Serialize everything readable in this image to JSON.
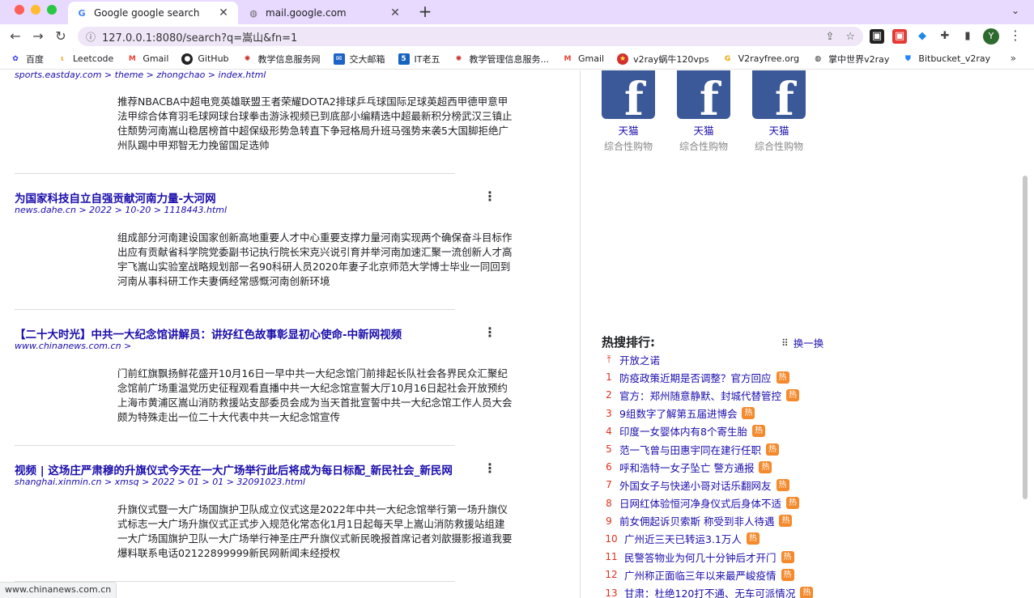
{
  "browser": {
    "tabs": [
      {
        "title": "Google google search",
        "active": true,
        "icon": "google-g-icon"
      },
      {
        "title": "mail.google.com",
        "active": false,
        "icon": "globe-icon"
      }
    ],
    "url": "127.0.0.1:8080/search?q=嵩山&fn=1",
    "avatar_letter": "Y",
    "bookmarks": [
      "百度",
      "Leetcode",
      "Gmail",
      "GitHub",
      "教学信息服务网",
      "交大邮箱",
      "IT老五",
      "教学管理信息服务...",
      "Gmail",
      "v2ray蜗牛120vps",
      "V2rayfree.org",
      "掌中世界v2ray",
      "Bitbucket_v2ray"
    ],
    "status_url": "www.chinanews.com.cn"
  },
  "results": {
    "top_cite": "sports.eastday.com > theme > zhongchao > index.html",
    "top_snippet": "推荐NBACBA中超电竞英雄联盟王者荣耀DOTA2排球乒乓球国际足球英超西甲德甲意甲法甲综合体育羽毛球网球台球拳击游泳视频已到底部小编精选中超最新积分榜武汉三镇止住颓势河南嵩山稳居榜首中超保级形势急转直下争冠格局升班马强势来袭5大国脚拒绝广州队踢中甲郑智无力挽留国足选帅",
    "items": [
      {
        "title": "为国家科技自立自强贡献河南力量-大河网",
        "url": "news.dahe.cn > 2022 > 10-20 > 1118443.html",
        "snippet": "组成部分河南建设国家创新高地重要人才中心重要支撑力量河南实现两个确保奋斗目标作出应有贡献省科学院党委副书记执行院长宋克兴说引育并举河南加速汇聚一流创新人才高宇飞嵩山实验室战略规划部一名90科研人员2020年妻子北京师范大学博士毕业一同回到河南从事科研工作夫妻俩经常感慨河南创新环境"
      },
      {
        "title": "【二十大时光】中共一大纪念馆讲解员：讲好红色故事彰显初心使命-中新网视频",
        "url": "www.chinanews.com.cn >",
        "snippet": "门前红旗飘扬鲜花盛开10月16日一早中共一大纪念馆门前排起长队社会各界民众汇聚纪念馆前广场重温党历史征程观看直播中共一大纪念馆宣誓大厅10月16日起社会开放预约上海市黄浦区嵩山消防救援站支部委员会成为当天首批宣誓中共一大纪念馆工作人员大会颇为特殊走出一位二十大代表中共一大纪念馆宣传"
      },
      {
        "title": "视频 | 这场庄严肃穆的升旗仪式今天在一大广场举行此后将成为每日标配_新民社会_新民网",
        "url": "shanghai.xinmin.cn > xmsq > 2022 > 01 > 01 > 32091023.html",
        "snippet": "升旗仪式暨一大广场国旗护卫队成立仪式这是2022年中共一大纪念馆举行第一场升旗仪式标志一大广场升旗仪式正式步入规范化常态化1月1日起每天早上嵩山消防救援站组建一大广场国旗护卫队一大广场举行神圣庄严升旗仪式新民晚报首席记者刘歆摄影报道我要爆料联系电话02122899999新民网新闻未经授权"
      }
    ]
  },
  "sidebar": {
    "cards": [
      {
        "name": "天猫",
        "desc": "综合性购物"
      },
      {
        "name": "天猫",
        "desc": "综合性购物"
      },
      {
        "name": "天猫",
        "desc": "综合性购物"
      }
    ],
    "hot_title": "热搜排行:",
    "swap_label": "换一换",
    "pinned": "开放之诺",
    "hot_badge": "热",
    "hot_items": [
      {
        "rank": "1",
        "text": "防疫政策近期是否调整？官方回应"
      },
      {
        "rank": "2",
        "text": "官方：郑州随意静默、封城代替管控"
      },
      {
        "rank": "3",
        "text": "9组数字了解第五届进博会"
      },
      {
        "rank": "4",
        "text": "印度一女婴体内有8个寄生胎"
      },
      {
        "rank": "5",
        "text": "范一飞曾与田惠宇同在建行任职"
      },
      {
        "rank": "6",
        "text": "呼和浩特一女子坠亡 警方通报"
      },
      {
        "rank": "7",
        "text": "外国女子与快递小哥对话乐翻网友"
      },
      {
        "rank": "8",
        "text": "日网红体验恒河净身仪式后身体不适"
      },
      {
        "rank": "9",
        "text": "前女佣起诉贝索斯 称受到非人待遇"
      },
      {
        "rank": "10",
        "text": "广州近三天已转运3.1万人"
      },
      {
        "rank": "11",
        "text": "民警答物业为何几十分钟后才开门"
      },
      {
        "rank": "12",
        "text": "广州称正面临三年以来最严峻疫情"
      },
      {
        "rank": "13",
        "text": "甘肃：杜绝120打不通、无车可派情况"
      }
    ]
  }
}
